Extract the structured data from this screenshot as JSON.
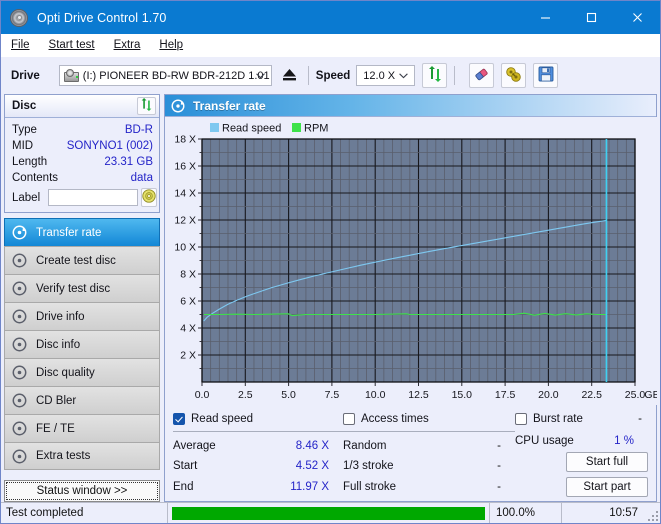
{
  "window": {
    "title": "Opti Drive Control 1.70",
    "icon": "disc-icon",
    "minimize": "minimize-icon",
    "maximize": "maximize-icon",
    "close": "close-icon",
    "titlebar_color": "#0a7ad1"
  },
  "menu": [
    {
      "label": "File",
      "accel": "F"
    },
    {
      "label": "Start test",
      "accel": "S"
    },
    {
      "label": "Extra",
      "accel": "x"
    },
    {
      "label": "Help",
      "accel": "H"
    }
  ],
  "toolbar": {
    "drive_label": "Drive",
    "drive_value": "(I:)  PIONEER BD-RW  BDR-212D 1.01",
    "eject_icon": "eject-icon",
    "speed_label": "Speed",
    "speed_value": "12.0 X",
    "refresh_icon": "refresh-icon",
    "eraser_icon": "eraser-icon",
    "tools_icon": "tools-icon",
    "save_icon": "save-icon"
  },
  "disc": {
    "header": "Disc",
    "refresh_icon": "refresh-icon",
    "rows": [
      {
        "key": "Type",
        "value": "BD-R"
      },
      {
        "key": "MID",
        "value": "SONYNO1 (002)"
      },
      {
        "key": "Length",
        "value": "23.31 GB"
      },
      {
        "key": "Contents",
        "value": "data"
      }
    ],
    "label_key": "Label",
    "label_value": "",
    "label_placeholder": "",
    "disc_button_icon": "cd-icon"
  },
  "sidebar": {
    "items": [
      {
        "label": "Transfer rate",
        "active": true
      },
      {
        "label": "Create test disc",
        "active": false
      },
      {
        "label": "Verify test disc",
        "active": false
      },
      {
        "label": "Drive info",
        "active": false
      },
      {
        "label": "Disc info",
        "active": false
      },
      {
        "label": "Disc quality",
        "active": false
      },
      {
        "label": "CD Bler",
        "active": false
      },
      {
        "label": "FE / TE",
        "active": false
      },
      {
        "label": "Extra tests",
        "active": false
      }
    ],
    "status_window_button": "Status window >>"
  },
  "panel": {
    "title": "Transfer rate",
    "icon": "disc-icon"
  },
  "chart_data": {
    "type": "line",
    "title": "Transfer rate",
    "xlabel": "GB",
    "ylabel": "X",
    "xlim": [
      0.0,
      25.0
    ],
    "ylim": [
      0,
      18
    ],
    "xticks": [
      "0.0",
      "2.5",
      "5.0",
      "7.5",
      "10.0",
      "12.5",
      "15.0",
      "17.5",
      "20.0",
      "22.5",
      "25.0"
    ],
    "xtick_values": [
      0,
      2.5,
      5,
      7.5,
      10,
      12.5,
      15,
      17.5,
      20,
      22.5,
      25
    ],
    "yticks": [
      "2 X",
      "4 X",
      "6 X",
      "8 X",
      "10 X",
      "12 X",
      "14 X",
      "16 X",
      "18 X"
    ],
    "ytick_values": [
      2,
      4,
      6,
      8,
      10,
      12,
      14,
      16,
      18
    ],
    "x_unit_label": "GB",
    "grid": true,
    "legend_position": "top-left",
    "plot_bg": "#6c7c96",
    "cursor_x": 23.35,
    "cursor_color": "#3fd0f0",
    "legend": [
      {
        "name": "Read speed",
        "color": "#7ec8f0"
      },
      {
        "name": "RPM",
        "color": "#3ee24a"
      }
    ],
    "series": [
      {
        "name": "Read speed",
        "color": "#7ec8f0",
        "x": [
          0.1,
          0.3,
          0.6,
          1.0,
          1.5,
          2.0,
          2.6,
          3.2,
          4.0,
          4.8,
          5.6,
          6.5,
          7.4,
          8.3,
          9.2,
          10.2,
          11.2,
          12.2,
          13.2,
          14.3,
          15.4,
          16.5,
          17.6,
          18.7,
          19.8,
          20.9,
          22.0,
          23.0,
          23.35
        ],
        "y": [
          4.52,
          4.8,
          5.08,
          5.4,
          5.76,
          6.05,
          6.36,
          6.63,
          6.98,
          7.28,
          7.56,
          7.86,
          8.13,
          8.4,
          8.66,
          8.93,
          9.19,
          9.44,
          9.69,
          9.95,
          10.2,
          10.45,
          10.7,
          10.95,
          11.2,
          11.45,
          11.7,
          11.9,
          11.97
        ]
      },
      {
        "name": "RPM",
        "color": "#3ee24a",
        "x": [
          0.1,
          1.0,
          2.0,
          3.0,
          4.0,
          5.0,
          5.2,
          6.0,
          8.0,
          10.0,
          11.8,
          12.0,
          14.0,
          16.0,
          18.0,
          18.6,
          19.2,
          19.8,
          20.4,
          21.0,
          21.6,
          22.2,
          22.8,
          23.35
        ],
        "y": [
          5.0,
          5.0,
          5.02,
          5.0,
          5.02,
          5.05,
          4.92,
          5.0,
          5.0,
          5.0,
          5.05,
          5.0,
          5.0,
          5.0,
          5.0,
          5.1,
          4.95,
          5.08,
          4.96,
          5.06,
          4.97,
          5.05,
          5.0,
          5.0
        ]
      }
    ]
  },
  "stats": {
    "col1": {
      "checkbox_label": "Read speed",
      "checked": true,
      "rows": [
        {
          "key": "Average",
          "value": "8.46 X"
        },
        {
          "key": "Start",
          "value": "4.52 X"
        },
        {
          "key": "End",
          "value": "11.97 X"
        }
      ]
    },
    "col2": {
      "checkbox_label": "Access times",
      "checked": false,
      "rows": [
        {
          "key": "Random",
          "value": "-"
        },
        {
          "key": "1/3 stroke",
          "value": "-"
        },
        {
          "key": "Full stroke",
          "value": "-"
        }
      ]
    },
    "col3": {
      "checkbox_label": "Burst rate",
      "checked": false,
      "burst_value": "-",
      "cpu_key": "CPU usage",
      "cpu_value": "1 %",
      "start_full": "Start full",
      "start_part": "Start part"
    }
  },
  "statusbar": {
    "message": "Test completed",
    "percent_label": "100.0%",
    "percent_value": 100,
    "time": "10:57",
    "bar_color": "#00a800"
  }
}
